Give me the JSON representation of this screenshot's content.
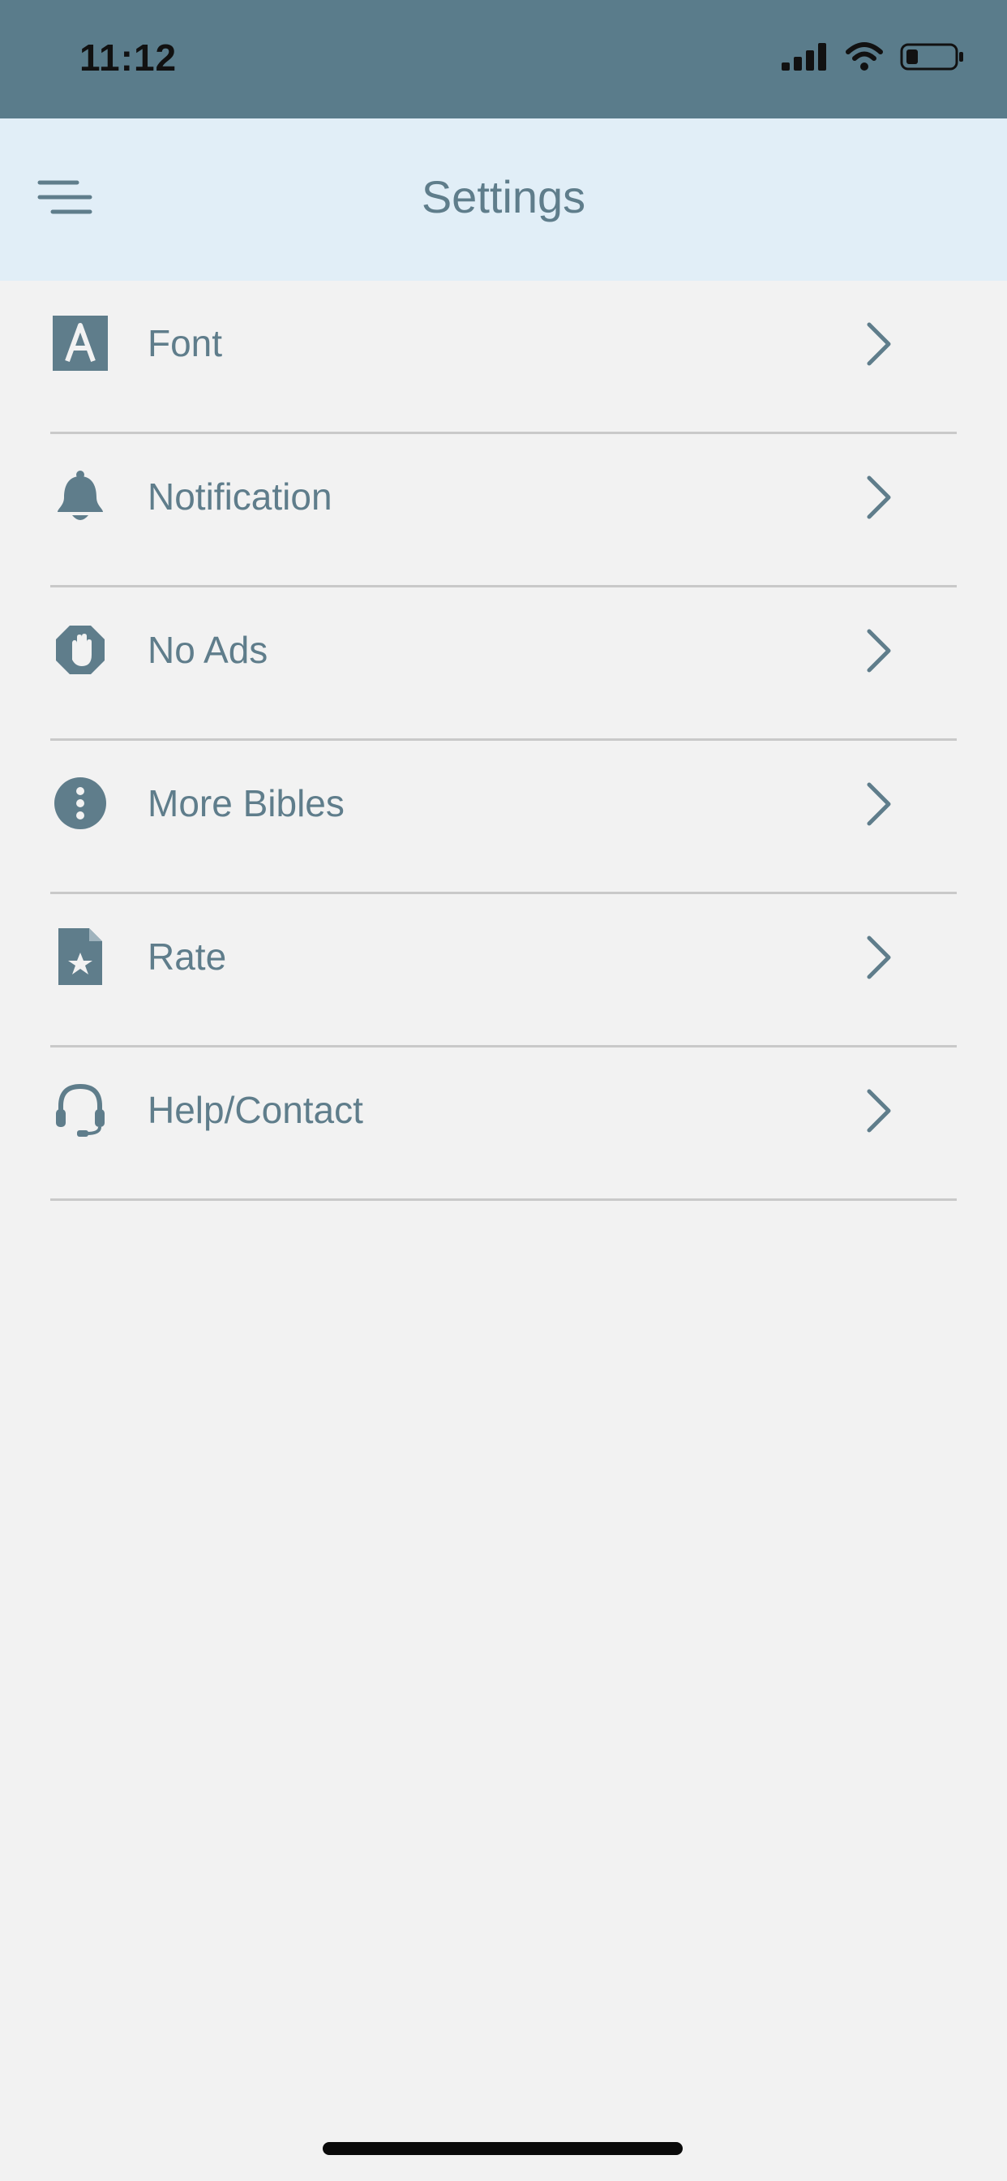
{
  "status_bar": {
    "time": "11:12"
  },
  "header": {
    "title": "Settings",
    "menu_icon": "hamburger-menu-icon"
  },
  "settings": {
    "items": [
      {
        "label": "Font",
        "icon": "font-a-icon"
      },
      {
        "label": "Notification",
        "icon": "bell-icon"
      },
      {
        "label": "No Ads",
        "icon": "stop-hand-icon"
      },
      {
        "label": "More Bibles",
        "icon": "info-circle-icon"
      },
      {
        "label": "Rate",
        "icon": "star-document-icon"
      },
      {
        "label": "Help/Contact",
        "icon": "headset-icon"
      }
    ]
  },
  "colors": {
    "status_bar": "#5a7c8b",
    "header_bg": "#e1eef7",
    "accent": "#5f7d8b",
    "background": "#f2f2f2",
    "divider": "#c9c9c9"
  }
}
